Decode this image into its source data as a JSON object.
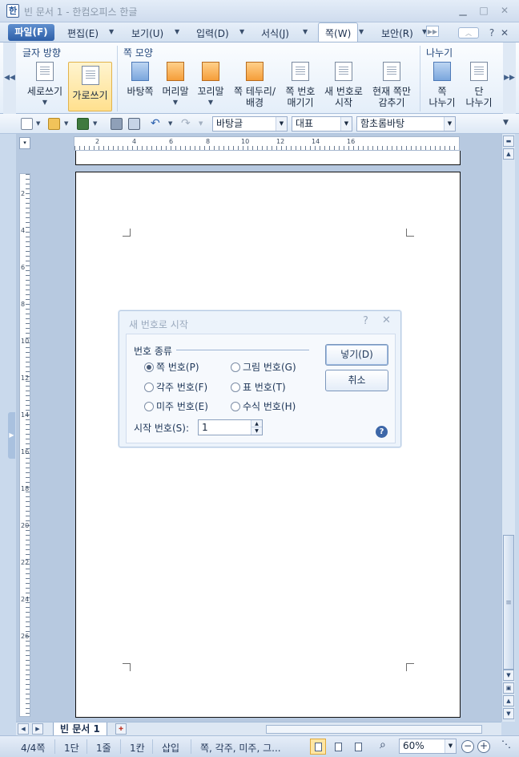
{
  "window": {
    "title": "빈 문서 1 - 한컴오피스 한글",
    "app_icon": "한"
  },
  "menubar": {
    "items": [
      {
        "label": "파일(F)"
      },
      {
        "label": "편집(E)"
      },
      {
        "label": "보기(U)"
      },
      {
        "label": "입력(D)"
      },
      {
        "label": "서식(J)"
      },
      {
        "label": "쪽(W)"
      },
      {
        "label": "보안(R)"
      }
    ]
  },
  "ribbon": {
    "groups": [
      "글자 방향",
      "쪽 모양",
      "나누기"
    ],
    "buttons": {
      "vertical_writing": "세로쓰기",
      "horizontal_writing": "가로쓰기",
      "background": "바탕쪽",
      "header": "머리말",
      "footer": "꼬리말",
      "border_l1": "쪽 테두리/",
      "border_l2": "배경",
      "pagenum_l1": "쪽 번호",
      "pagenum_l2": "매기기",
      "newnum_l1": "새 번호로",
      "newnum_l2": "시작",
      "hide_l1": "현재 쪽만",
      "hide_l2": "감추기",
      "pagebreak_l1": "쪽",
      "pagebreak_l2": "나누기",
      "colbreak_l1": "단",
      "colbreak_l2": "나누기"
    }
  },
  "toolbar": {
    "style": "바탕글",
    "lang": "대표",
    "font": "함초롬바탕"
  },
  "ruler": {
    "h_labels": [
      "2",
      "4",
      "6",
      "8",
      "10",
      "12",
      "14",
      "16"
    ],
    "v_labels": [
      "2",
      "4",
      "6",
      "8",
      "10",
      "12",
      "14",
      "16",
      "18",
      "20",
      "22",
      "24",
      "26"
    ]
  },
  "dialog": {
    "title": "새 번호로 시작",
    "group_label": "번호 종류",
    "radios": [
      {
        "label": "쪽 번호(P)",
        "checked": true
      },
      {
        "label": "그림 번호(G)",
        "checked": false
      },
      {
        "label": "각주 번호(F)",
        "checked": false
      },
      {
        "label": "표 번호(T)",
        "checked": false
      },
      {
        "label": "미주 번호(E)",
        "checked": false
      },
      {
        "label": "수식 번호(H)",
        "checked": false
      }
    ],
    "insert_button": "넣기(D)",
    "cancel_button": "취소",
    "start_label": "시작 번호(S):",
    "start_value": "1"
  },
  "tabs": {
    "doc_tab": "빈 문서 1"
  },
  "status": {
    "page": "4/4쪽",
    "column": "1단",
    "line": "1줄",
    "col": "1칸",
    "mode": "삽입",
    "info": "쪽, 각주, 미주, 그...",
    "zoom": "60%"
  },
  "colors": {
    "accent": "#2d5fa8",
    "ribbon_selected": "#ffe08e",
    "dialog_bg": "#ecf3fb"
  }
}
